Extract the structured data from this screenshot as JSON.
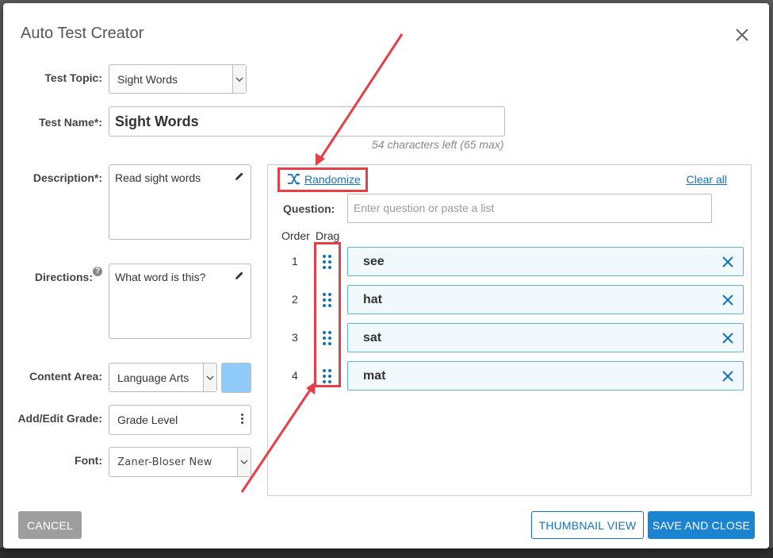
{
  "dialog": {
    "title": "Auto Test Creator"
  },
  "form": {
    "test_topic_label": "Test Topic:",
    "test_topic_value": "Sight Words",
    "test_name_label": "Test Name*:",
    "test_name_value": "Sight Words",
    "char_hint": "54 characters left (65 max)",
    "description_label": "Description*:",
    "description_value": "Read sight words",
    "directions_label": "Directions:",
    "directions_help": "?",
    "directions_value": "What word is this?",
    "content_area_label": "Content Area:",
    "content_area_value": "Language Arts",
    "content_area_color": "#90caf9",
    "grade_label": "Add/Edit Grade:",
    "grade_value": "Grade Level",
    "font_label": "Font:",
    "font_value": "Zaner-Bloser New"
  },
  "questions": {
    "randomize_label": "Randomize",
    "clear_all_label": "Clear all",
    "question_label": "Question:",
    "question_placeholder": "Enter question or paste a list",
    "order_header": "Order",
    "drag_header": "Drag",
    "items": [
      {
        "order": "1",
        "word": "see"
      },
      {
        "order": "2",
        "word": "hat"
      },
      {
        "order": "3",
        "word": "sat"
      },
      {
        "order": "4",
        "word": "mat"
      }
    ]
  },
  "footer": {
    "cancel_label": "CANCEL",
    "thumbnail_label": "THUMBNAIL VIEW",
    "save_label": "SAVE AND CLOSE"
  },
  "colors": {
    "accent": "#1672b7",
    "primary_button": "#1a84d1",
    "annotation": "#e53f47"
  }
}
